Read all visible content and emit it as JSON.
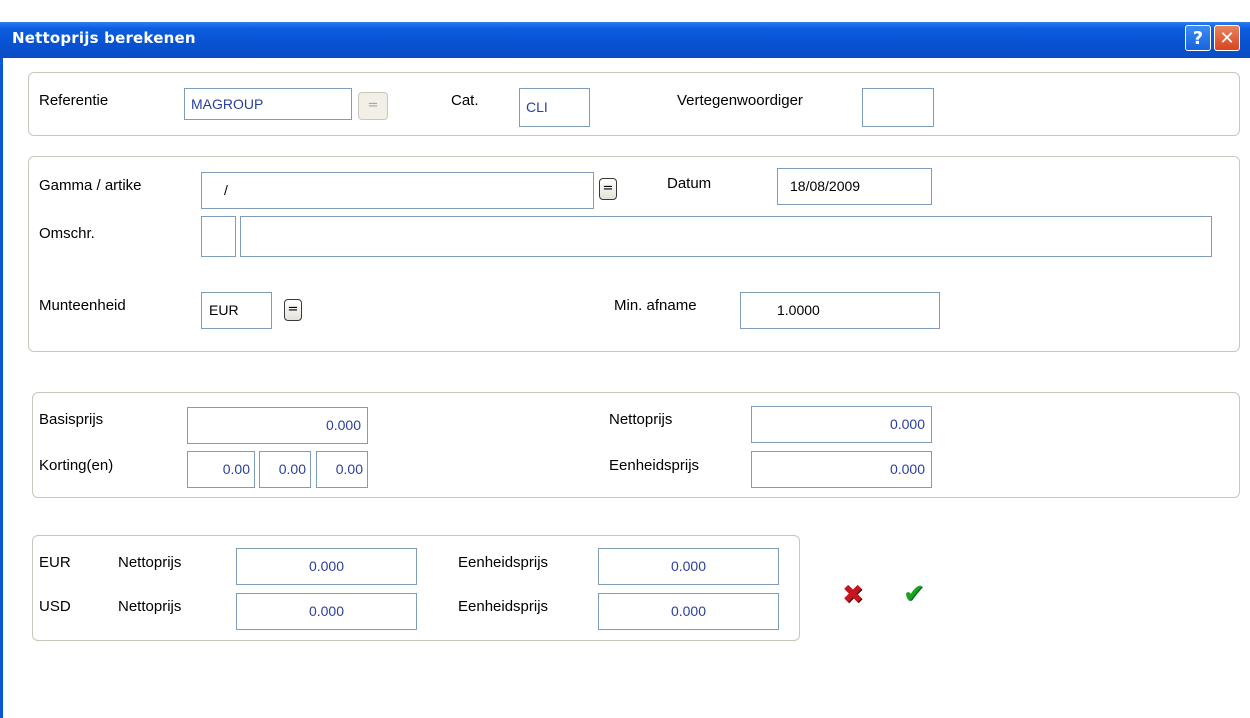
{
  "window": {
    "title": "Nettoprijs berekenen",
    "help_label": "?",
    "close_label": "✕"
  },
  "header": {
    "referentie_label": "Referentie",
    "referentie_value": "MAGROUP",
    "ref_lookup_label": "=",
    "cat_label": "Cat.",
    "cat_value": "CLI",
    "vertegenwoordiger_label": "Vertegenwoordiger",
    "vertegenwoordiger_value": ""
  },
  "article": {
    "gamma_label": "Gamma / artike",
    "gamma_value": "/",
    "gamma_lookup_label": "=",
    "datum_label": "Datum",
    "datum_value": "18/08/2009",
    "omschr_label": "Omschr.",
    "omschr_code": "",
    "omschr_value": "",
    "munteenheid_label": "Munteenheid",
    "munteenheid_value": "EUR",
    "munteenheid_lookup_label": "=",
    "min_afname_label": "Min. afname",
    "min_afname_value": "1.0000"
  },
  "prices": {
    "basisprijs_label": "Basisprijs",
    "basisprijs_value": "0.000",
    "kortingen_label": "Korting(en)",
    "korting1": "0.00",
    "korting2": "0.00",
    "korting3": "0.00",
    "nettoprijs_label": "Nettoprijs",
    "nettoprijs_value": "0.000",
    "eenheidsprijs_label": "Eenheidsprijs",
    "eenheidsprijs_value": "0.000"
  },
  "currencies": [
    {
      "code": "EUR",
      "netto_label": "Nettoprijs",
      "netto_value": "0.000",
      "eenheid_label": "Eenheidsprijs",
      "eenheid_value": "0.000"
    },
    {
      "code": "USD",
      "netto_label": "Nettoprijs",
      "netto_value": "0.000",
      "eenheid_label": "Eenheidsprijs",
      "eenheid_value": "0.000"
    }
  ],
  "actions": {
    "cancel_icon": "cancel-x-icon",
    "confirm_icon": "confirm-check-icon"
  },
  "colors": {
    "titlebar": "#0a5ee0",
    "field_border": "#7f9db9",
    "field_text": "#2a3f9c",
    "cancel": "#c8141e",
    "confirm": "#1aa41a"
  }
}
